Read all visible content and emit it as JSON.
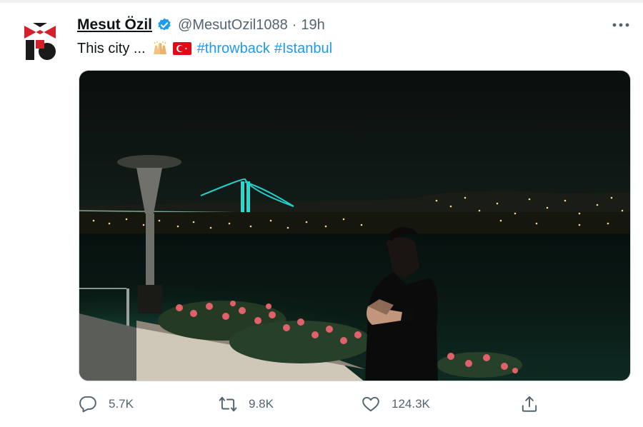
{
  "tweet": {
    "author_name": "Mesut Özil",
    "handle": "@MesutOzil1088",
    "separator": "·",
    "time": "19h",
    "text": "This city ...",
    "emojis": [
      "raising-hands-icon",
      "turkey-flag-icon"
    ],
    "hashtags": [
      "#throwback",
      "#Istanbul"
    ],
    "verified": true
  },
  "media": {
    "type": "photo",
    "subject": "man in black t-shirt at Bosphorus waterfront at night"
  },
  "actions": {
    "reply": {
      "icon": "reply-icon",
      "count": "5.7K"
    },
    "retweet": {
      "icon": "retweet-icon",
      "count": "9.8K"
    },
    "like": {
      "icon": "heart-icon",
      "count": "124.3K"
    },
    "share": {
      "icon": "share-icon"
    }
  },
  "colors": {
    "link": "#1d9bf0",
    "secondary_text": "#536471",
    "verified": "#1d9bf0",
    "logo_red": "#d4202a"
  }
}
